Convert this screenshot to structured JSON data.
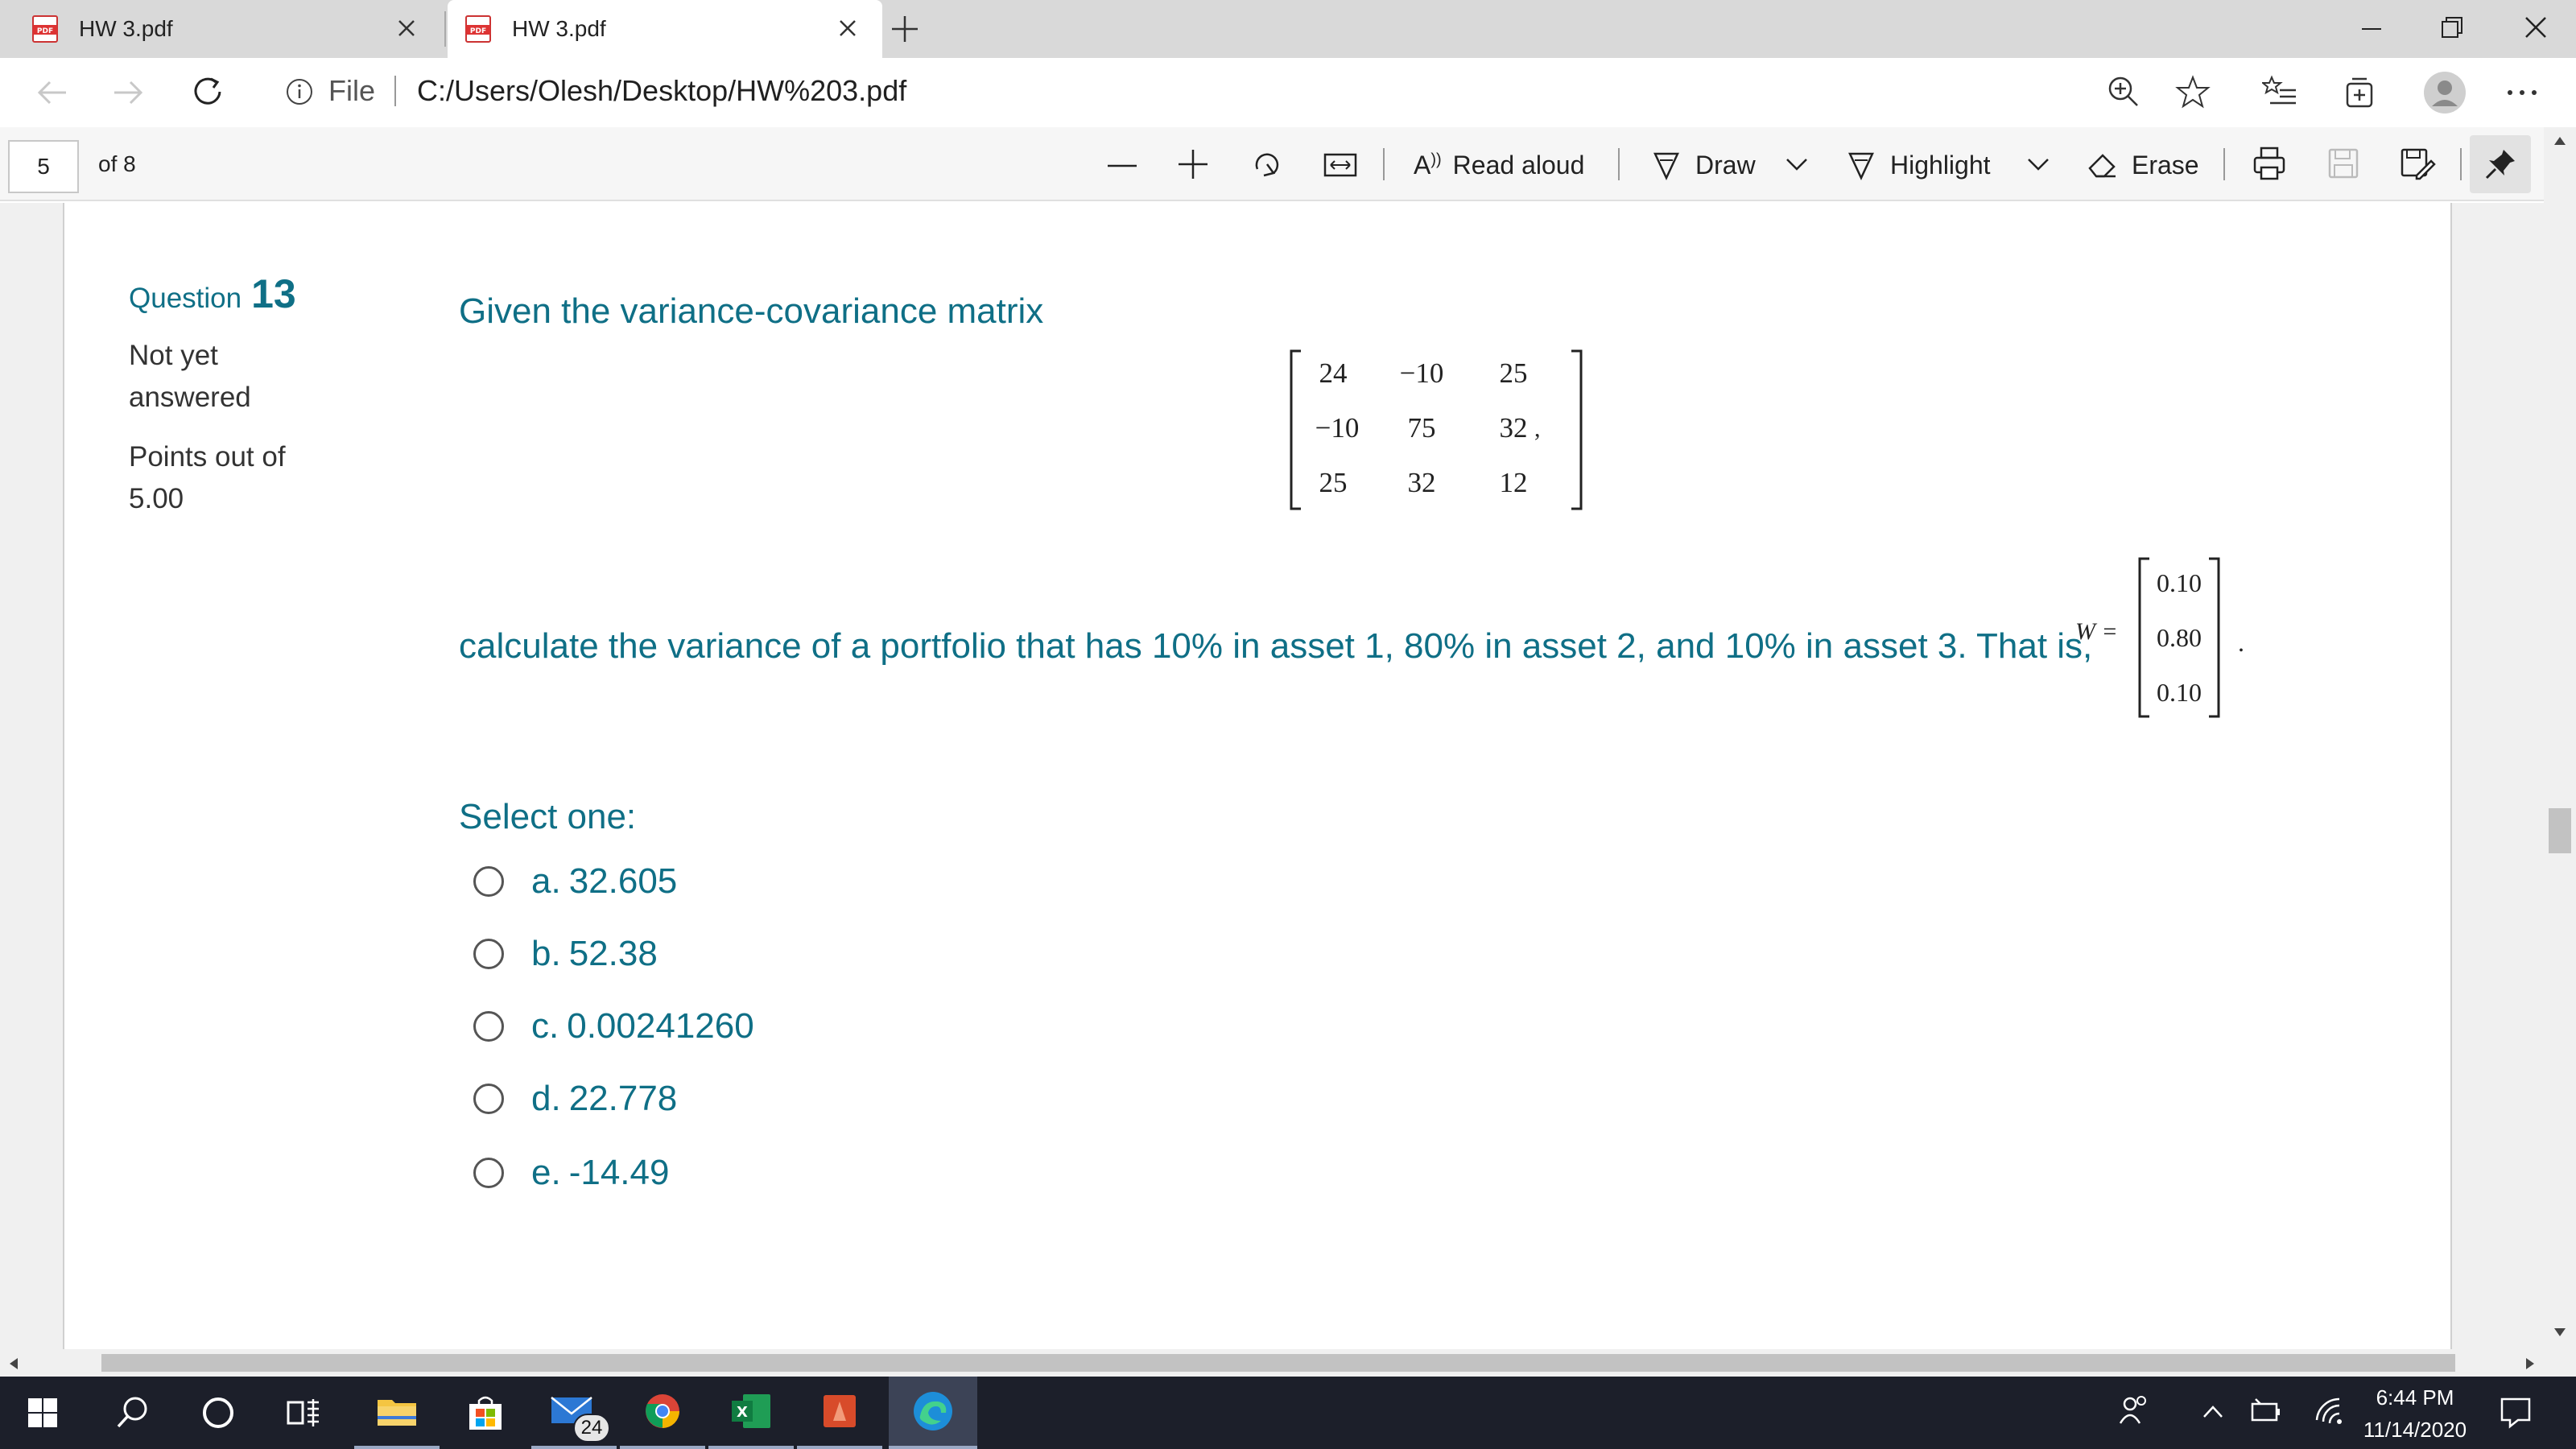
{
  "browser": {
    "tabs": [
      {
        "title": "HW 3.pdf",
        "icon": "pdf-icon",
        "active": false
      },
      {
        "title": "HW 3.pdf",
        "icon": "pdf-icon",
        "active": true
      }
    ],
    "address": {
      "scheme_label": "File",
      "url": "C:/Users/Olesh/Desktop/HW%203.pdf"
    }
  },
  "pdf_toolbar": {
    "page_number": "5",
    "page_total": "of 8",
    "read_aloud": "Read aloud",
    "draw": "Draw",
    "highlight": "Highlight",
    "erase": "Erase"
  },
  "question": {
    "label": "Question",
    "number": "13",
    "status_line1": "Not yet",
    "status_line2": "answered",
    "points_line1": "Points out of",
    "points_line2": "5.00",
    "prompt": "Given the variance-covariance matrix",
    "matrix": [
      [
        "24",
        "−10",
        "25"
      ],
      [
        "−10",
        "75",
        "32"
      ],
      [
        "25",
        "32",
        "12"
      ]
    ],
    "matrix_suffix": ",",
    "body": "calculate the variance of a portfolio that has 10% in asset 1, 80% in asset 2, and 10% in asset 3.  That is,",
    "weights_label": "W =",
    "weights": [
      "0.10",
      "0.80",
      "0.10"
    ],
    "weights_suffix": ".",
    "select_label": "Select one:",
    "options": [
      {
        "letter": "a.",
        "value": "32.605"
      },
      {
        "letter": "b.",
        "value": "52.38"
      },
      {
        "letter": "c.",
        "value": "0.00241260"
      },
      {
        "letter": "d.",
        "value": "22.778"
      },
      {
        "letter": "e.",
        "value": "-14.49"
      }
    ]
  },
  "taskbar": {
    "mail_badge": "24",
    "time": "6:44 PM",
    "date": "11/14/2020"
  },
  "colors": {
    "accent": "#0f6f86",
    "taskbar": "#1c1f2a",
    "tabbar": "#d9d9d9"
  }
}
